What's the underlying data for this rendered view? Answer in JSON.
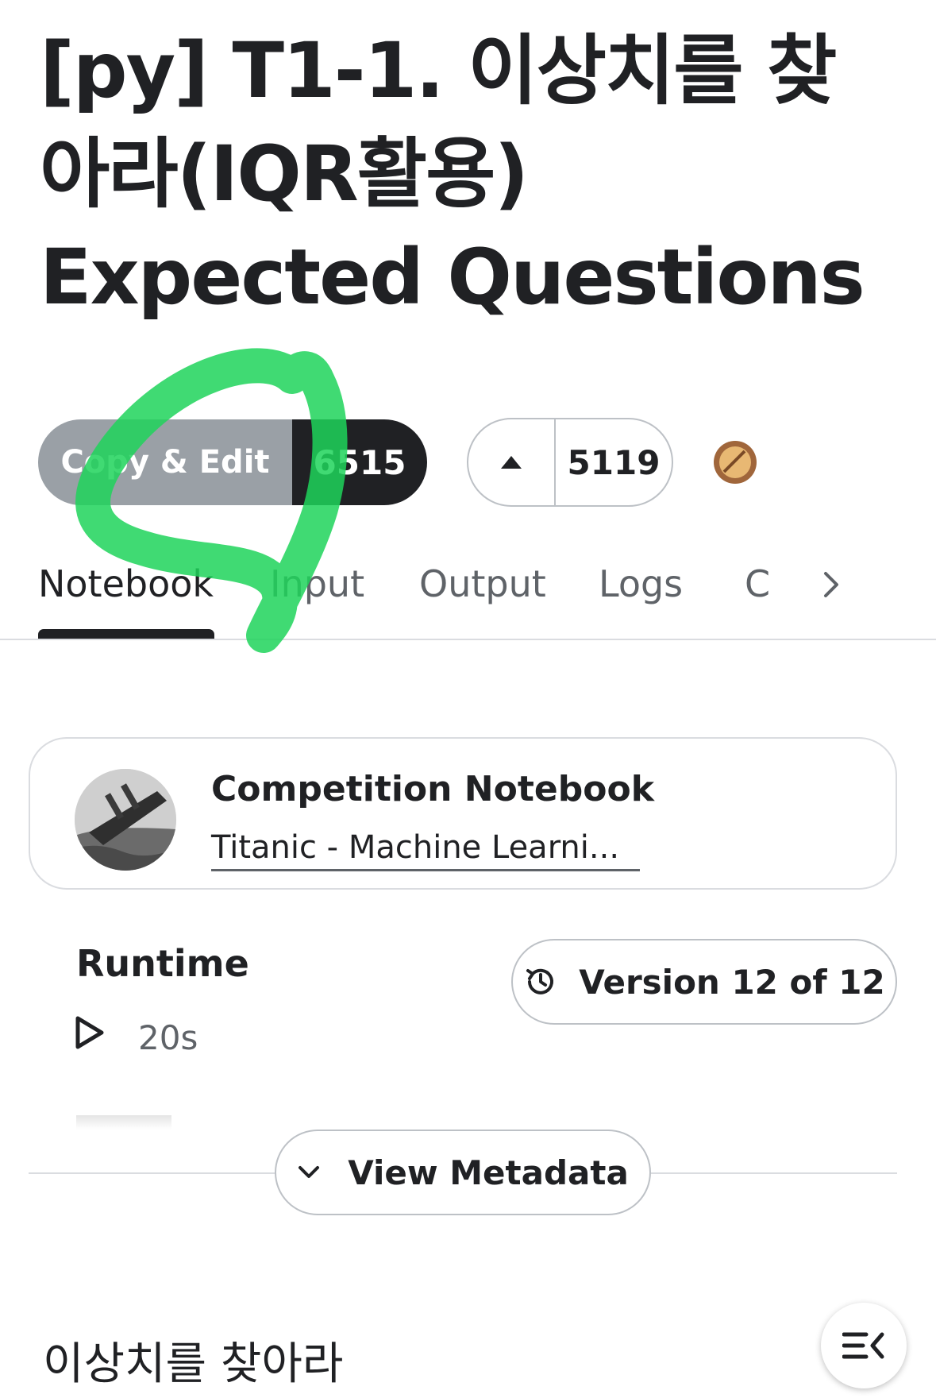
{
  "title": {
    "line1": "[py] T1-1. 이상치를 찾",
    "line2": "아라(IQR활용)",
    "line3": "Expected Questions"
  },
  "actions": {
    "copy_edit_label": "Copy & Edit",
    "copy_count": "6515",
    "upvote_count": "5119",
    "medal_icon": "bronze-medal-icon"
  },
  "tabs": {
    "items": [
      "Notebook",
      "Input",
      "Output",
      "Logs",
      "C"
    ],
    "active": "Notebook"
  },
  "competition": {
    "heading": "Competition Notebook",
    "link_text": "Titanic - Machine Learni..."
  },
  "runtime": {
    "label": "Runtime",
    "value": "20s"
  },
  "version": {
    "label": "Version 12 of 12"
  },
  "metadata": {
    "button_label": "View Metadata"
  },
  "section": {
    "heading": "이상치를 찾아라"
  },
  "colors": {
    "primary_dark": "#202124",
    "copy_button_gray": "#9aa0a6",
    "border": "#dadce0",
    "muted_text": "#5f6368",
    "medal_bronze": "#a0663b",
    "annotation_green": "#1ed35a"
  }
}
